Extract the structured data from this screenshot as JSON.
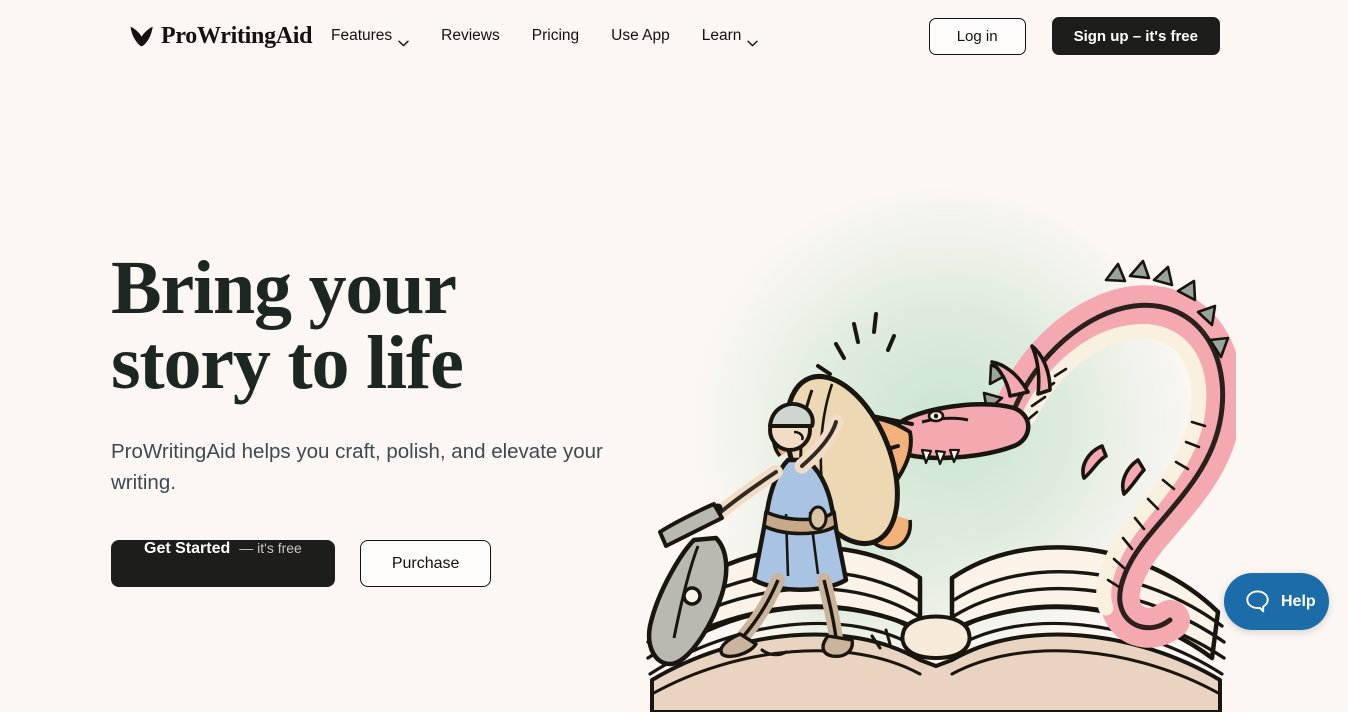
{
  "brand": {
    "name": "ProWritingAid",
    "logo_icon": "book-mark-icon",
    "bg_color": "#fdf7f3",
    "ink_color": "#14110f"
  },
  "header": {
    "nav": [
      {
        "label": "Features",
        "has_dropdown": true,
        "icon": "chevron-down-icon"
      },
      {
        "label": "Reviews",
        "has_dropdown": false,
        "icon": ""
      },
      {
        "label": "Pricing",
        "has_dropdown": false,
        "icon": ""
      },
      {
        "label": "Use App",
        "has_dropdown": false,
        "icon": ""
      },
      {
        "label": "Learn",
        "has_dropdown": true,
        "icon": "chevron-down-icon"
      }
    ],
    "login_label": "Log in",
    "signup_label": "Sign up – it's free"
  },
  "hero": {
    "headline": "Bring your\nstory to life",
    "subhead": "ProWritingAid helps you craft, polish, and elevate your writing.",
    "cta_primary_main": "Get Started",
    "cta_primary_sub": "— it's free",
    "cta_secondary": "Purchase",
    "illustration_alt": "knight-with-pen-sword-fighting-dragon-on-open-book"
  },
  "help_widget": {
    "label": "Help",
    "icon": "chat-bubble-icon",
    "color": "#1b6ca8"
  }
}
